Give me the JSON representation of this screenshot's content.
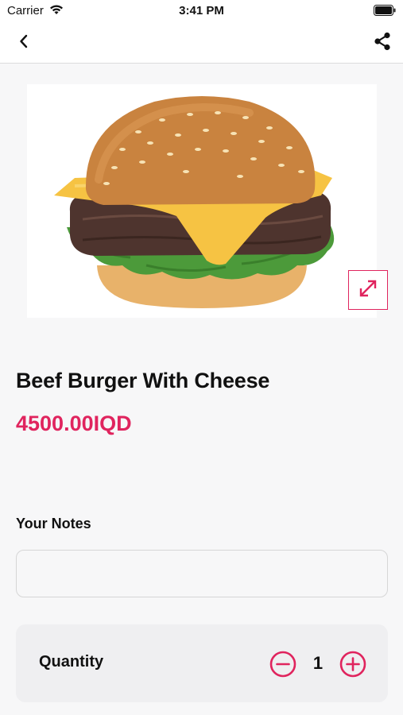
{
  "status_bar": {
    "carrier": "Carrier",
    "time": "3:41 PM",
    "icons": [
      "wifi-icon",
      "battery-icon"
    ]
  },
  "nav": {
    "back_icon": "chevron-left-icon",
    "share_icon": "share-icon"
  },
  "product": {
    "image": "beef-burger-with-cheese-photo",
    "expand_icon": "expand-arrows-icon",
    "title": "Beef Burger With Cheese",
    "price": "4500.00IQD"
  },
  "notes": {
    "label": "Your Notes",
    "value": "",
    "placeholder": ""
  },
  "quantity": {
    "label": "Quantity",
    "value": "1",
    "minus_icon": "minus-circle-icon",
    "plus_icon": "plus-circle-icon"
  },
  "colors": {
    "accent": "#e0245e",
    "background": "#f7f7f8",
    "card": "#efeff1"
  }
}
